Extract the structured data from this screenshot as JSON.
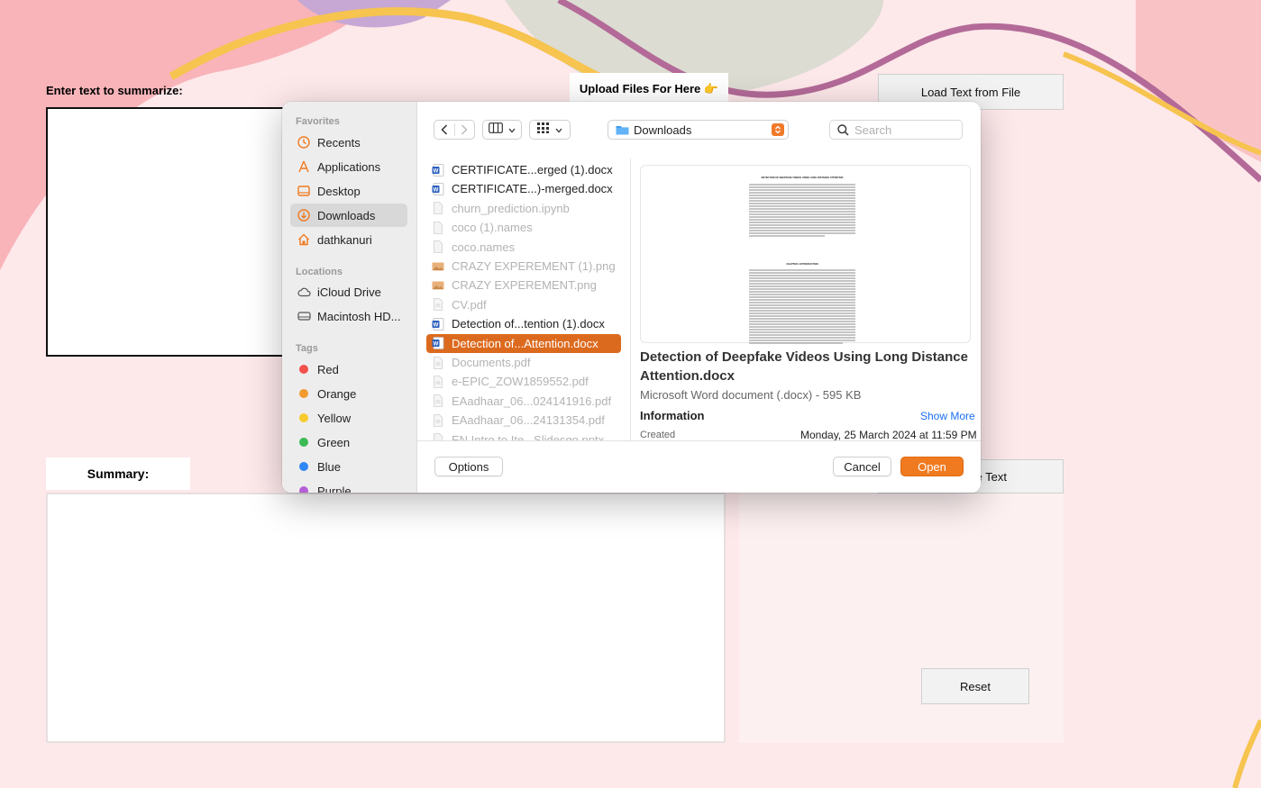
{
  "app": {
    "enter_label": "Enter text to summarize:",
    "upload_label": "Upload Files For Here 👉",
    "load_button": "Load Text from File",
    "summary_label": "Summary:",
    "summarize_button_visible_text": "e Text",
    "reset_button": "Reset"
  },
  "dialog": {
    "sidebar": {
      "favorites_head": "Favorites",
      "favorites": [
        {
          "label": "Recents",
          "icon": "clock-icon"
        },
        {
          "label": "Applications",
          "icon": "applications-icon"
        },
        {
          "label": "Desktop",
          "icon": "desktop-icon"
        },
        {
          "label": "Downloads",
          "icon": "download-icon",
          "selected": true
        },
        {
          "label": "dathkanuri",
          "icon": "home-icon"
        }
      ],
      "locations_head": "Locations",
      "locations": [
        {
          "label": "iCloud Drive",
          "icon": "cloud-icon"
        },
        {
          "label": "Macintosh HD...",
          "icon": "disk-icon"
        }
      ],
      "tags_head": "Tags",
      "tags": [
        {
          "label": "Red",
          "color": "#f2504b"
        },
        {
          "label": "Orange",
          "color": "#f29a2e"
        },
        {
          "label": "Yellow",
          "color": "#f7cb2d"
        },
        {
          "label": "Green",
          "color": "#3cba54"
        },
        {
          "label": "Blue",
          "color": "#2f86f6"
        },
        {
          "label": "Purple",
          "color": "#b55fd6"
        }
      ]
    },
    "location": "Downloads",
    "search_placeholder": "Search",
    "files": [
      {
        "name": "CERTIFICATE...erged (1).docx",
        "type": "docx",
        "enabled": true
      },
      {
        "name": "CERTIFICATE...)-merged.docx",
        "type": "docx",
        "enabled": true
      },
      {
        "name": "churn_prediction.ipynb",
        "type": "generic",
        "enabled": false
      },
      {
        "name": "coco (1).names",
        "type": "generic",
        "enabled": false
      },
      {
        "name": "coco.names",
        "type": "generic",
        "enabled": false
      },
      {
        "name": "CRAZY EXPEREMENT (1).png",
        "type": "image",
        "enabled": false
      },
      {
        "name": "CRAZY EXPEREMENT.png",
        "type": "image",
        "enabled": false
      },
      {
        "name": "CV.pdf",
        "type": "pdf",
        "enabled": false
      },
      {
        "name": "Detection of...tention (1).docx",
        "type": "docx",
        "enabled": true
      },
      {
        "name": "Detection of...Attention.docx",
        "type": "docx",
        "enabled": true,
        "selected": true
      },
      {
        "name": "Documents.pdf",
        "type": "pdf",
        "enabled": false
      },
      {
        "name": "e-EPIC_ZOW1859552.pdf",
        "type": "pdf",
        "enabled": false
      },
      {
        "name": "EAadhaar_06...024141916.pdf",
        "type": "pdf",
        "enabled": false
      },
      {
        "name": "EAadhaar_06...24131354.pdf",
        "type": "pdf",
        "enabled": false
      },
      {
        "name": "EN Intro to Ite...Slidesgo.pptx",
        "type": "generic",
        "enabled": false
      }
    ],
    "preview": {
      "title": "Detection of Deepfake Videos Using Long Distance Attention.docx",
      "kind": "Microsoft Word document (.docx) - 595 KB",
      "info_head": "Information",
      "show_more": "Show More",
      "created_label": "Created",
      "created_value": "Monday, 25 March 2024 at 11:59 PM",
      "doc_heading": "DETECTION OF DEEPFAKE VIDEOS USING LONG DISTANCE ATTENTION",
      "doc_chapter": "CHAPTER 1 INTRODUCTION"
    },
    "options_button": "Options",
    "cancel_button": "Cancel",
    "open_button": "Open"
  },
  "colors": {
    "accent": "#f07a1f",
    "selection": "#dc6a1e",
    "link": "#1a6ff0"
  }
}
